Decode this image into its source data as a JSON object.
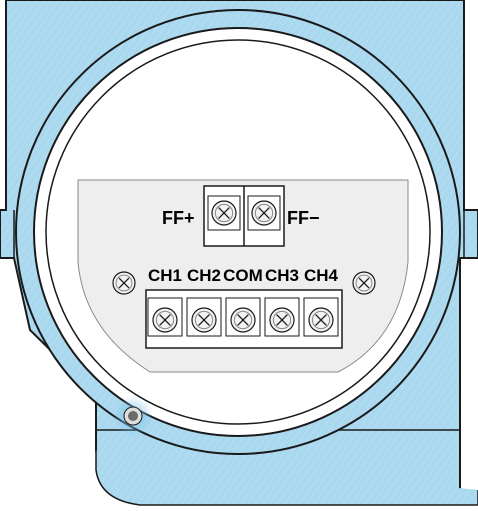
{
  "colors": {
    "housing": "#a9d8ef",
    "housing_dark": "#8cc3e0",
    "outline": "#1a1a1a",
    "plate": "#eeeeee",
    "terminal": "#ffffff",
    "screw": "#f2f2f2",
    "led": "#6a6a6a",
    "led_glow": "#7ec4ea"
  },
  "top_terminals": {
    "positive_label": "FF+",
    "negative_label": "FF−"
  },
  "bottom_terminals": {
    "labels": [
      "CH1",
      "CH2",
      "COM",
      "CH3",
      "CH4"
    ]
  }
}
